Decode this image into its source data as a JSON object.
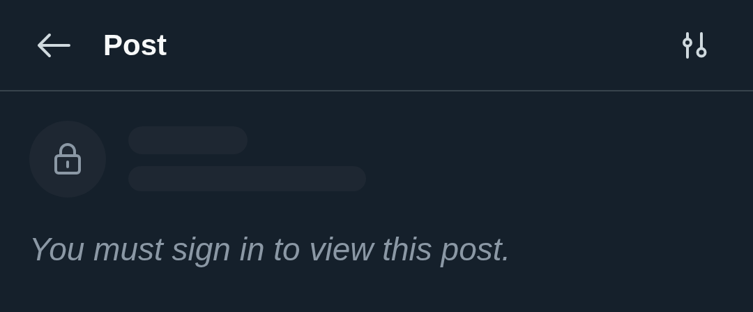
{
  "header": {
    "title": "Post"
  },
  "message": "You must sign in to view this post."
}
